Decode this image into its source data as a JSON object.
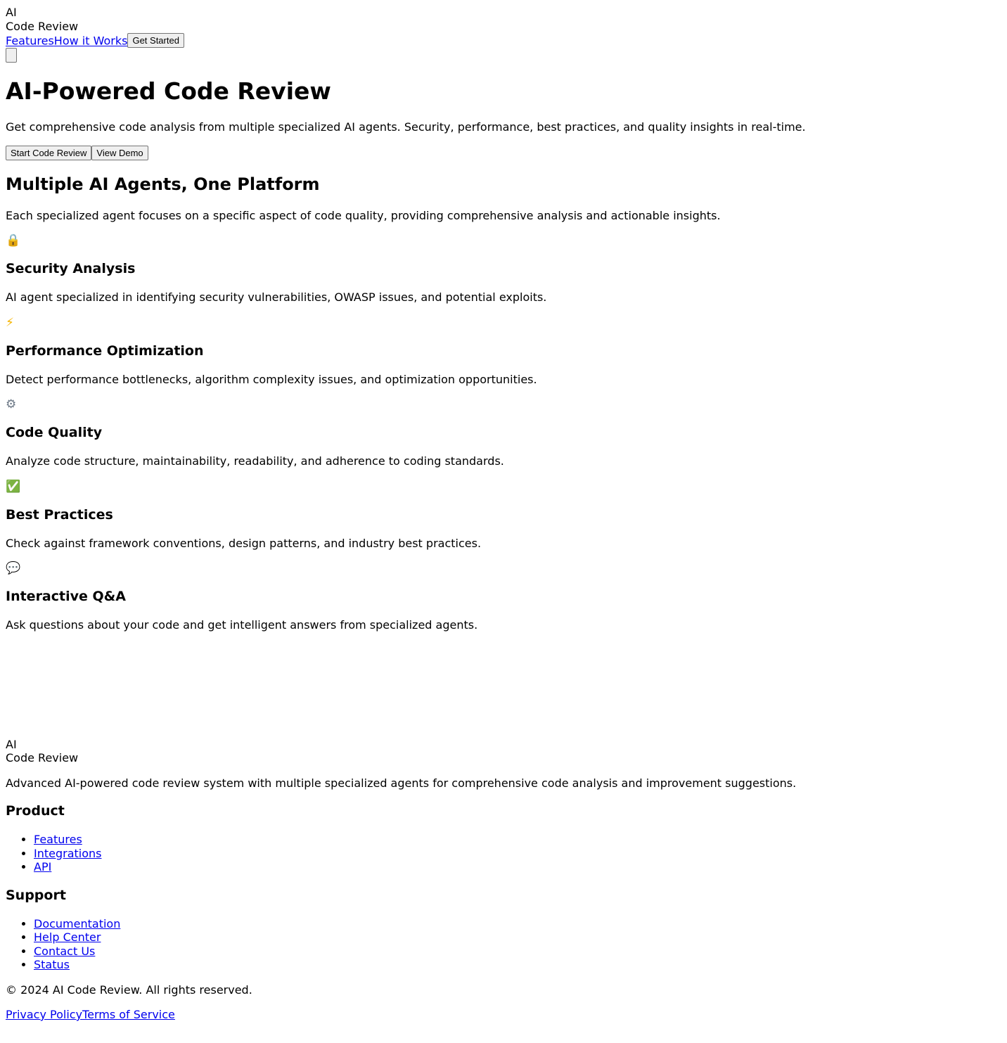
{
  "header": {
    "logo_line1": "AI",
    "logo_line2": "Code Review",
    "nav": [
      {
        "label": "Features"
      },
      {
        "label": "How it Works"
      }
    ],
    "cta_label": "Get Started"
  },
  "hero": {
    "title": "AI-Powered Code Review",
    "subtitle": "Get comprehensive code analysis from multiple specialized AI agents. Security, performance, best practices, and quality insights in real-time.",
    "primary_button": "Start Code Review",
    "secondary_button": "View Demo"
  },
  "features": {
    "heading": "Multiple AI Agents, One Platform",
    "intro": "Each specialized agent focuses on a specific aspect of code quality, providing comprehensive analysis and actionable insights.",
    "items": [
      {
        "icon": "lock-icon",
        "glyph": "🔒",
        "title": "Security Analysis",
        "description": "AI agent specialized in identifying security vulnerabilities, OWASP issues, and potential exploits."
      },
      {
        "icon": "lightning-icon",
        "glyph": "⚡",
        "title": "Performance Optimization",
        "description": "Detect performance bottlenecks, algorithm complexity issues, and optimization opportunities."
      },
      {
        "icon": "gear-icon",
        "glyph": "⚙",
        "title": "Code Quality",
        "description": "Analyze code structure, maintainability, readability, and adherence to coding standards."
      },
      {
        "icon": "check-icon",
        "glyph": "✅",
        "title": "Best Practices",
        "description": "Check against framework conventions, design patterns, and industry best practices."
      },
      {
        "icon": "speech-bubble-icon",
        "glyph": "💬",
        "title": "Interactive Q&A",
        "description": "Ask questions about your code and get intelligent answers from specialized agents."
      }
    ]
  },
  "footer": {
    "logo_line1": "AI",
    "logo_line2": "Code Review",
    "description": "Advanced AI-powered code review system with multiple specialized agents for comprehensive code analysis and improvement suggestions.",
    "product": {
      "heading": "Product",
      "links": [
        "Features",
        "Integrations",
        "API"
      ]
    },
    "support": {
      "heading": "Support",
      "links": [
        "Documentation",
        "Help Center",
        "Contact Us",
        "Status"
      ]
    },
    "copyright": "© 2024 AI Code Review. All rights reserved.",
    "legal_links": [
      "Privacy Policy",
      "Terms of Service"
    ]
  },
  "colors": {
    "link": "#0000ee",
    "text": "#000000",
    "button_bg": "#efefef"
  }
}
